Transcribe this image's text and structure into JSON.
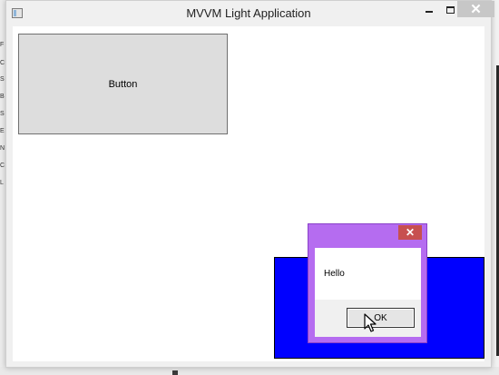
{
  "window": {
    "title": "MVVM Light Application",
    "minimize_icon": "minimize-icon",
    "maximize_icon": "maximize-icon",
    "close_glyph": "✕"
  },
  "main": {
    "button_label": "Button",
    "panel_color": "#0000ff"
  },
  "dialog": {
    "message": "Hello",
    "ok_label": "OK",
    "close_glyph": "✕",
    "accent_color": "#b56cf0"
  },
  "background": {
    "left_letters": [
      "F",
      "C",
      "S",
      "B",
      "S",
      "E",
      "N",
      "C",
      "L"
    ]
  }
}
